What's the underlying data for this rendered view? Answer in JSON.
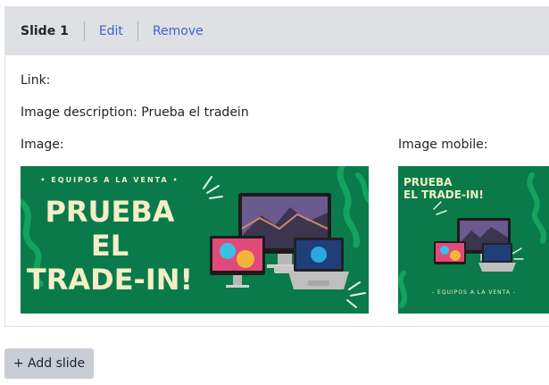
{
  "slide": {
    "title": "Slide 1",
    "edit_label": "Edit",
    "remove_label": "Remove",
    "link_label": "Link:",
    "description_label": "Image description: Prueba el tradein",
    "image_label": "Image:",
    "image_mobile_label": "Image mobile:"
  },
  "banner": {
    "kicker": "• EQUIPOS A LA VENTA •",
    "headline_1": "PRUEBA",
    "headline_2": "EL",
    "headline_3": "TRADE-IN!",
    "mobile_headline_1": "PRUEBA",
    "mobile_headline_2": "EL TRADE-IN!",
    "mobile_footer": "- EQUIPOS A LA VENTA -",
    "background_color": "#0a7a4a",
    "text_color": "#f4eec6"
  },
  "actions": {
    "add_slide_label": "+ Add slide"
  }
}
